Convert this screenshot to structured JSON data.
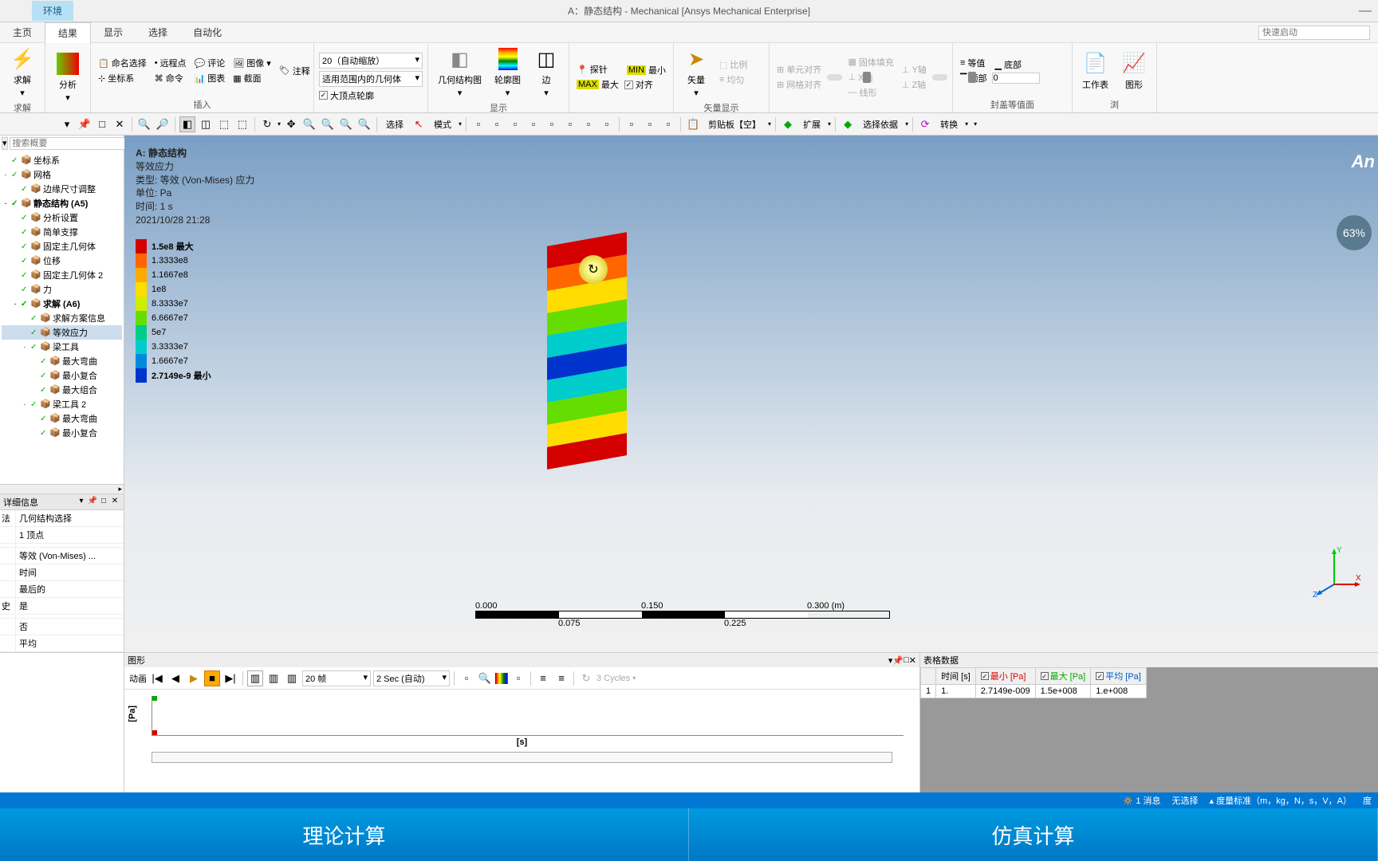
{
  "titlebar": {
    "env_tab": "环境",
    "title": "A：静态结构 - Mechanical [Ansys Mechanical Enterprise]"
  },
  "menubar": {
    "items": [
      "主页",
      "结果",
      "显示",
      "选择",
      "自动化"
    ],
    "active_index": 1,
    "quick_placeholder": "快速启动"
  },
  "ribbon": {
    "solve": {
      "label": "求解",
      "group": "求解"
    },
    "analyze": {
      "label": "分析",
      "group": "分析"
    },
    "insert": {
      "group": "插入",
      "items": [
        "命名选择",
        "远程点",
        "评论",
        "图像",
        "注释",
        "坐标系",
        "命令",
        "图表",
        "截面"
      ]
    },
    "style": {
      "combo1": "20（自动缩放）",
      "combo2": "适用范围内的几何体",
      "check": "大顶点轮廓"
    },
    "display": {
      "group": "显示",
      "geom": "几何结构图",
      "contour": "轮廓图",
      "edge": "边"
    },
    "probe": {
      "probe": "探针",
      "max": "最小",
      "min": "最大",
      "align": "对齐"
    },
    "vector": {
      "group": "矢量显示",
      "items": [
        "比例",
        "单元对齐",
        "固体填充",
        "Y轴",
        "均匀",
        "网格对齐",
        "X轴",
        "Z轴",
        "线形"
      ]
    },
    "contour_face": {
      "group": "封盖等值面",
      "items": [
        "等值",
        "底部",
        "顶部"
      ],
      "value": "0"
    },
    "export": {
      "worksheet": "工作表",
      "graph": "图形"
    }
  },
  "toolbar2": {
    "select": "选择",
    "mode": "模式",
    "clipboard": "剪贴板【空】",
    "extend": "扩展",
    "selectby": "选择依据",
    "convert": "转换"
  },
  "tree": {
    "search_placeholder": "搜索概要",
    "items": [
      {
        "t": "坐标系",
        "i": 0
      },
      {
        "t": "网格",
        "i": 0,
        "tog": "-"
      },
      {
        "t": "边缘尺寸调整",
        "i": 1
      },
      {
        "t": "静态结构 (A5)",
        "i": 0,
        "tog": "-",
        "bold": true
      },
      {
        "t": "分析设置",
        "i": 1
      },
      {
        "t": "简单支撑",
        "i": 1
      },
      {
        "t": "固定主几何体",
        "i": 1
      },
      {
        "t": "位移",
        "i": 1
      },
      {
        "t": "固定主几何体 2",
        "i": 1
      },
      {
        "t": "力",
        "i": 1
      },
      {
        "t": "求解 (A6)",
        "i": 1,
        "tog": "-",
        "bold": true
      },
      {
        "t": "求解方案信息",
        "i": 2
      },
      {
        "t": "等效应力",
        "i": 2,
        "sel": true
      },
      {
        "t": "梁工具",
        "i": 2,
        "tog": "-"
      },
      {
        "t": "最大弯曲",
        "i": 3
      },
      {
        "t": "最小复合",
        "i": 3
      },
      {
        "t": "最大组合",
        "i": 3
      },
      {
        "t": "梁工具 2",
        "i": 2,
        "tog": "-"
      },
      {
        "t": "最大弯曲",
        "i": 3
      },
      {
        "t": "最小复合",
        "i": 3
      }
    ]
  },
  "details": {
    "title": "详细信息",
    "rows": [
      {
        "k": "法",
        "v": "几何结构选择"
      },
      {
        "k": "",
        "v": "1 顶点"
      },
      {
        "k": "",
        "v": ""
      },
      {
        "k": "",
        "v": "等效 (Von-Mises) ..."
      },
      {
        "k": "",
        "v": "时间"
      },
      {
        "k": "",
        "v": "最后的"
      },
      {
        "k": "史",
        "v": "是"
      },
      {
        "k": "",
        "v": ""
      },
      {
        "k": "",
        "v": "否"
      },
      {
        "k": "",
        "v": "平均"
      }
    ]
  },
  "viewport": {
    "info": {
      "title": "A: 静态结构",
      "subtitle": "等效应力",
      "type": "类型: 等效 (Von-Mises) 应力",
      "unit": "单位: Pa",
      "time": "时间: 1 s",
      "date": "2021/10/28 21:28"
    },
    "legend": [
      {
        "c": "#d40000",
        "v": "1.5e8 最大",
        "b": true
      },
      {
        "c": "#ff6600",
        "v": "1.3333e8"
      },
      {
        "c": "#ffaa00",
        "v": "1.1667e8"
      },
      {
        "c": "#ffdd00",
        "v": "1e8"
      },
      {
        "c": "#ccee00",
        "v": "8.3333e7"
      },
      {
        "c": "#66dd00",
        "v": "6.6667e7"
      },
      {
        "c": "#00cc88",
        "v": "5e7"
      },
      {
        "c": "#00cccc",
        "v": "3.3333e7"
      },
      {
        "c": "#0088dd",
        "v": "1.6667e7"
      },
      {
        "c": "#0033cc",
        "v": "2.7149e-9 最小",
        "b": true
      }
    ],
    "scale": {
      "ticks_top": [
        "0.000",
        "0.150",
        "0.300 (m)"
      ],
      "ticks_bot": [
        "0.075",
        "0.225"
      ]
    },
    "ansys": "An",
    "progress": "63%",
    "triad": {
      "x": "X",
      "y": "Y",
      "z": "Z"
    }
  },
  "graph_panel": {
    "title": "图形",
    "anim": "动画",
    "frames": "20 帧",
    "duration": "2 Sec (自动)",
    "cycles": "3 Cycles",
    "ylabel": "[Pa]",
    "xlabel": "[s]"
  },
  "table_panel": {
    "title": "表格数据",
    "headers": {
      "idx": "",
      "time": "时间 [s]",
      "min": "最小 [Pa]",
      "max": "最大 [Pa]",
      "avg": "平均 [Pa]"
    },
    "row": {
      "idx": "1",
      "time": "1.",
      "min": "2.7149e-009",
      "max": "1.5e+008",
      "avg": "1.e+008"
    }
  },
  "statusbar": {
    "messages": "1 消息",
    "sel": "无选择",
    "units": "度量标准（m，kg，N，s，V，A）",
    "deg": "度"
  },
  "footer": {
    "left": "理论计算",
    "right": "仿真计算"
  }
}
